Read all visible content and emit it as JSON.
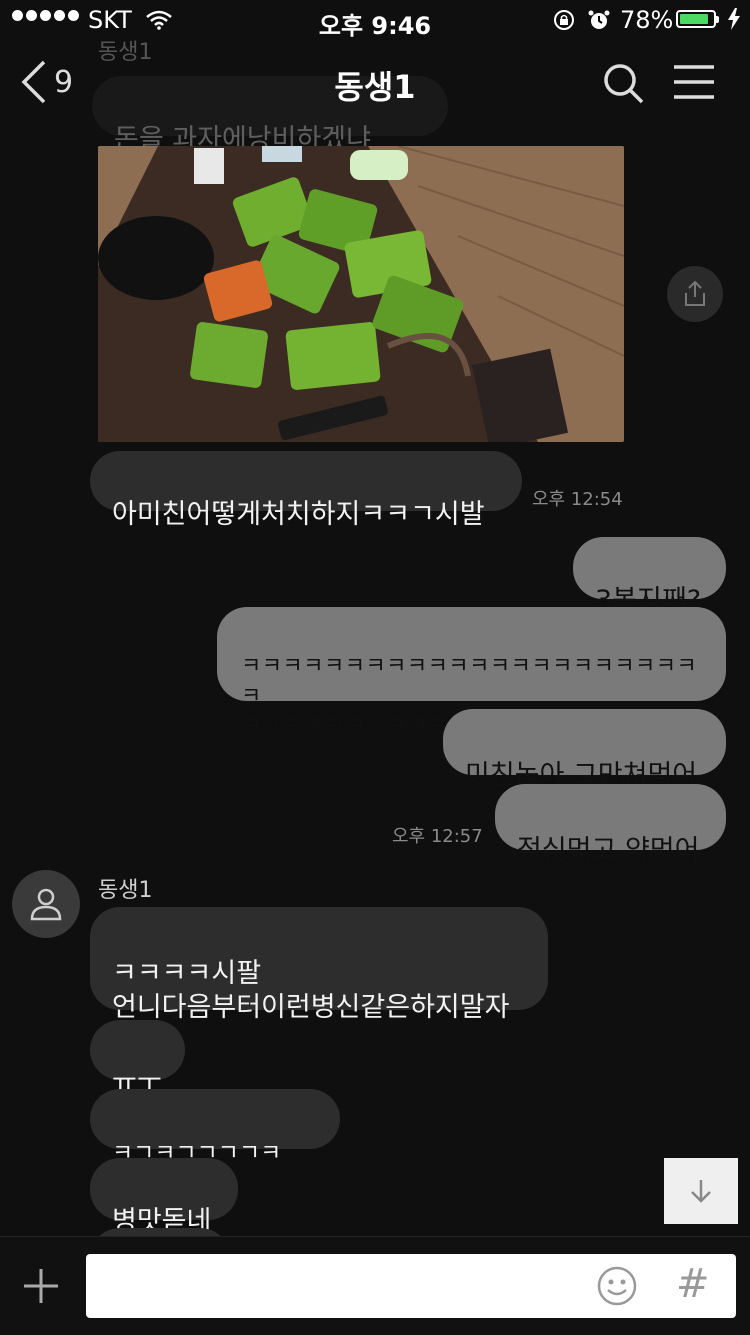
{
  "status_bar": {
    "carrier": "SKT",
    "time": "오후 9:46",
    "battery": "78%"
  },
  "header": {
    "back_count": "9",
    "title": "동생1",
    "faded_sender": "동생1",
    "faded_message": "돈을 과자에낭비하겠냐"
  },
  "messages": [
    {
      "text": "아미친어떻게처치하지ㅋㅋㄱ시발"
    },
    {
      "timestamp": "오후 12:54"
    },
    {
      "text": "3봉지째?"
    },
    {
      "text": "ㅋㅋㅋㅋㅋㅋㅋㅋㅋㅋㅋㅋㅋㅋㅋㅋㅋㅋㅋㅋㅋㅋㅋ\nㅋㅋㅋㅋㅋㅋㅋㅋㅋㅋ"
    },
    {
      "text": "미친놈아 그만쳐먹어"
    },
    {
      "text": "점심먹고 약먹어"
    },
    {
      "timestamp": "오후 12:57"
    },
    {
      "sender": "동생1"
    },
    {
      "text": "ㅋㅋㅋㅋ시팔\n언니다음부터이런병신같은하지말자"
    },
    {
      "text": "ㅠㅜ"
    },
    {
      "text": "ㅋㄱㅋㄱㄱㄱㄱㅋ"
    },
    {
      "text": "병맛돋네"
    }
  ],
  "input": {
    "value": "",
    "hash_label": "#"
  },
  "colors": {
    "background": "#0f0f0f",
    "incoming_bubble": "#2d2d2d",
    "outgoing_bubble": "#7a7a7a",
    "battery_fill": "#4cd964"
  },
  "icons": [
    "signal-dots-icon",
    "wifi-icon",
    "rotation-lock-icon",
    "alarm-icon",
    "battery-icon",
    "charging-bolt-icon",
    "back-chevron-icon",
    "search-icon",
    "menu-icon",
    "share-icon",
    "avatar-person-icon",
    "arrow-down-icon",
    "plus-icon",
    "emoji-icon"
  ]
}
